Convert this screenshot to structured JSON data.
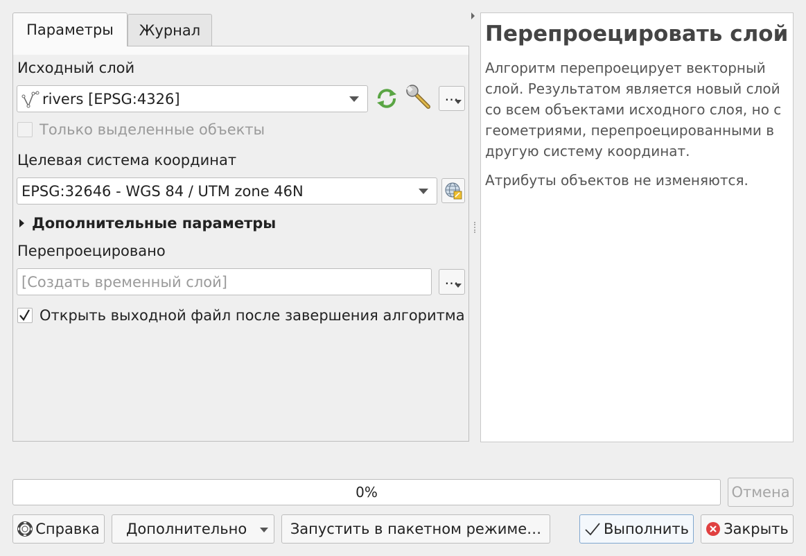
{
  "tabs": {
    "parameters": "Параметры",
    "log": "Журнал"
  },
  "form": {
    "input_layer_label": "Исходный слой",
    "input_layer_value": "rivers [EPSG:4326]",
    "selected_only_label": "Только выделенные объекты",
    "selected_only_checked": false,
    "target_crs_label": "Целевая система координат",
    "target_crs_value": "EPSG:32646 - WGS 84 / UTM zone 46N",
    "advanced_label": "Дополнительные параметры",
    "output_label": "Перепроецировано",
    "output_placeholder": "[Создать временный слой]",
    "ellipsis": "…",
    "open_output_label": "Открыть выходной файл после завершения алгоритма",
    "open_output_checked": true
  },
  "help": {
    "title": "Перепроецировать слой",
    "paragraph1": "Алгоритм перепроецирует векторный слой. Результатом является новый слой со всем объектами исходного слоя, но с геометриями, перепроецированными в другую систему координат.",
    "paragraph2": "Атрибуты объектов не изменяются."
  },
  "progress": {
    "value_percent": 0,
    "text": "0%"
  },
  "buttons": {
    "cancel": "Отмена",
    "help": "Справка",
    "advanced": "Дополнительно",
    "batch": "Запустить в пакетном режиме…",
    "run": "Выполнить",
    "close": "Закрыть"
  },
  "icons": {
    "layer_type": "line-layer-icon",
    "iterate": "iterate-icon",
    "settings": "wrench-icon",
    "crs_select": "globe-crs-icon",
    "help": "lifebuoy-icon",
    "run": "checkmark-icon",
    "close": "close-circle-icon"
  },
  "colors": {
    "iterate": "#5aa544",
    "close": "#e04040",
    "run_border": "#7fa7cf"
  }
}
